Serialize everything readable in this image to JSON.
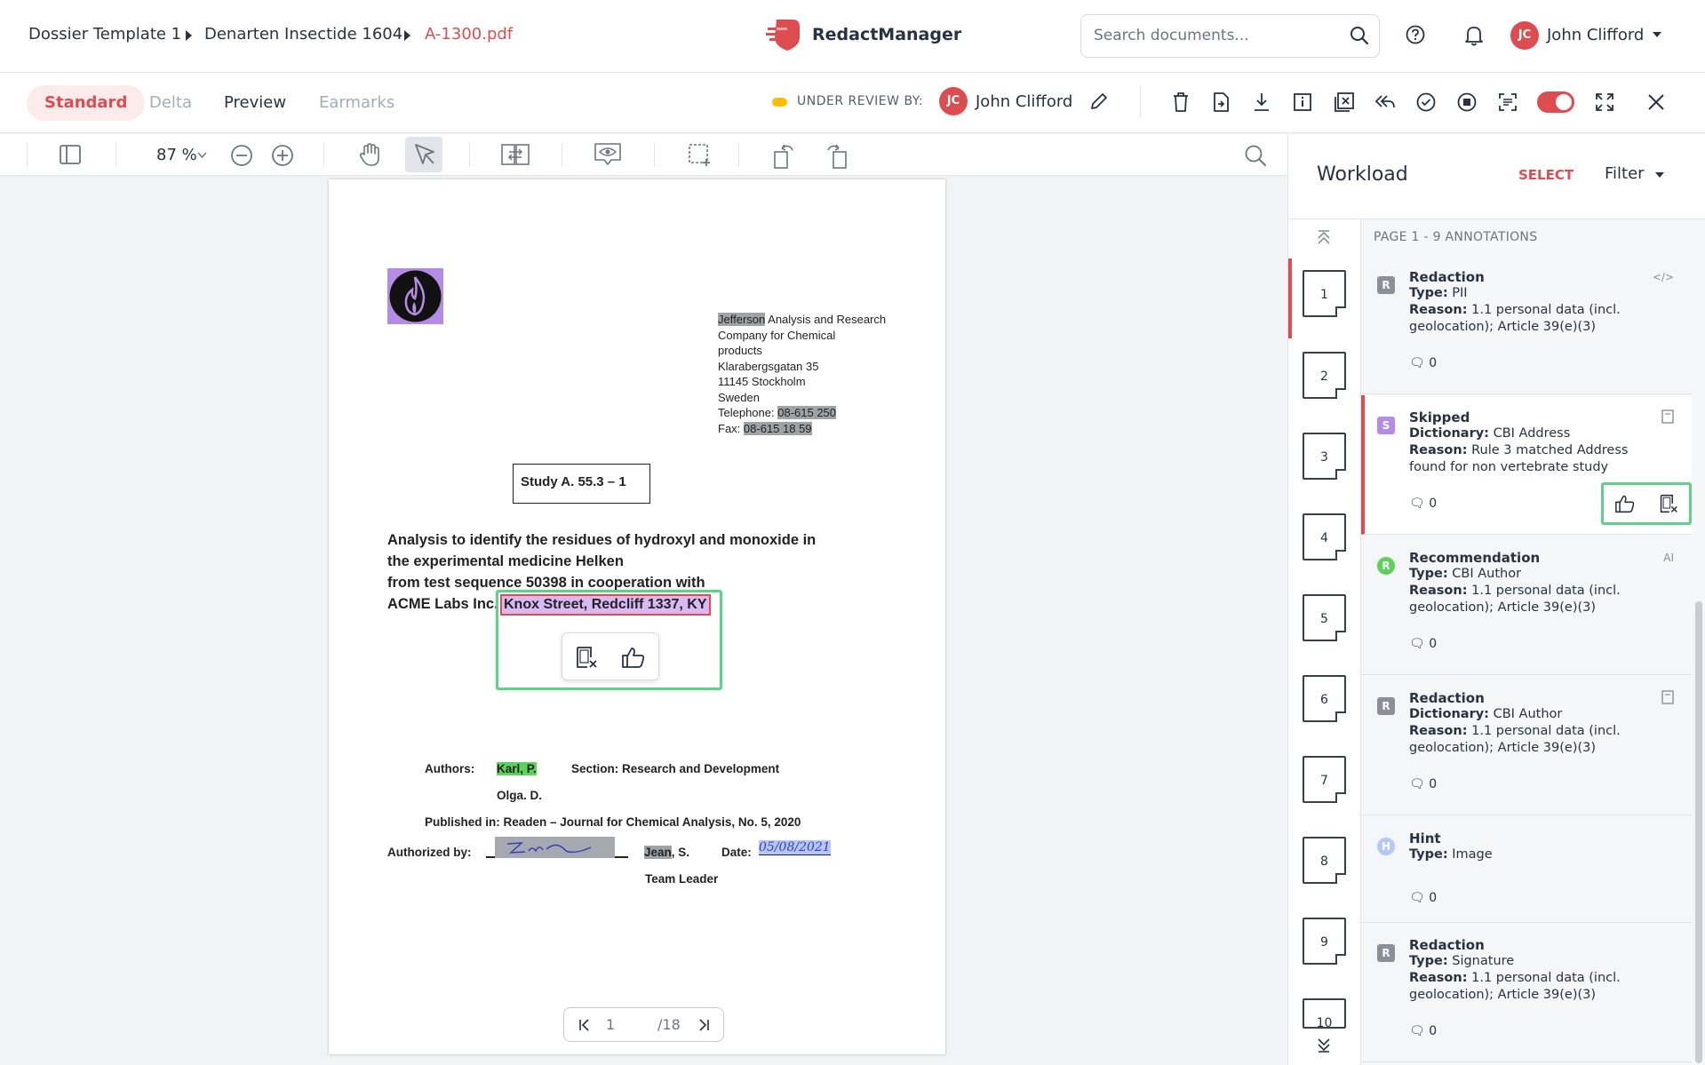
{
  "breadcrumb": {
    "items": [
      "Dossier Template 1",
      "Denarten Insectide 1604",
      "A-1300.pdf"
    ]
  },
  "brand": {
    "name": "RedactManager",
    "color": "#dd4d50"
  },
  "search": {
    "placeholder": "Search documents..."
  },
  "user": {
    "initials": "JC",
    "name": "John Clifford"
  },
  "modes": {
    "standard": "Standard",
    "delta": "Delta",
    "preview": "Preview",
    "earmarks": "Earmarks"
  },
  "review": {
    "label": "UNDER REVIEW BY:",
    "initials": "JC",
    "name": "John Clifford"
  },
  "viewer": {
    "zoom": "87 %"
  },
  "document": {
    "sender": {
      "name_hl": "Jefferson",
      "name_rest": " Analysis and Research",
      "line2": "Company for Chemical",
      "line3": "products",
      "street": "Klarabergsgatan 35",
      "city": "11145 Stockholm",
      "country": "Sweden",
      "tel_label": "Telephone: ",
      "tel_value": "08-615 250",
      "fax_label": "Fax: ",
      "fax_value": "08-615 18 59"
    },
    "study_box": "Study A. 55.3 – 1",
    "title_lines": [
      "Analysis to identify the residues of hydroxyl and monoxide in",
      "the experimental medicine Helken",
      "from test sequence 50398 in cooperation with"
    ],
    "lab_prefix": "ACME Labs Inc.",
    "lab_address": "Knox Street, Redcliff 1337, KY",
    "authors_label": "Authors:",
    "author1": "Karl, P.",
    "author2": "Olga. D.",
    "section": "Section: Research and Development",
    "published": "Published in: Readen – Journal for Chemical Analysis, No. 5, 2020",
    "authorized_label": "Authorized by:",
    "signer_hl": "Jean",
    "signer_rest": ", S.",
    "date_label": "Date:",
    "date_value": "05/08/2021",
    "team_leader": "Team Leader"
  },
  "pager": {
    "current": "1",
    "total": "/18"
  },
  "panel": {
    "title": "Workload",
    "select": "SELECT",
    "filter": "Filter",
    "header": "PAGE 1 - 9 ANNOTATIONS",
    "thumbs": [
      "1",
      "2",
      "3",
      "4",
      "5",
      "6",
      "7",
      "8",
      "9",
      "10"
    ],
    "cards": [
      {
        "badge": "R",
        "badge_color": "#8a8f99",
        "title": "Redaction",
        "l1k": "Type:",
        "l1v": " PII",
        "l2k": "Reason:",
        "l2v": " 1.1 personal data (incl. geolocation); Article 39(e)(3)",
        "comments": "0",
        "corner": "</>"
      },
      {
        "badge": "S",
        "badge_color": "#b48ce6",
        "title": "Skipped",
        "l1k": "Dictionary:",
        "l1v": " CBI Address",
        "l2k": "Reason:",
        "l2v": " Rule 3 matched Address found for non vertebrate study",
        "comments": "0",
        "corner": ""
      },
      {
        "badge": "R",
        "badge_color": "#5bd35b",
        "title": "Recommendation",
        "l1k": "Type:",
        "l1v": " CBI Author",
        "l2k": "Reason:",
        "l2v": " 1.1 personal data (incl. geolocation); Article 39(e)(3)",
        "comments": "0",
        "corner": "AI"
      },
      {
        "badge": "R",
        "badge_color": "#8a8f99",
        "title": "Redaction",
        "l1k": "Dictionary:",
        "l1v": " CBI Author",
        "l2k": "Reason:",
        "l2v": " 1.1 personal data (incl. geolocation); Article 39(e)(3)",
        "comments": "0",
        "corner": ""
      },
      {
        "badge": "H",
        "badge_color": "#b5c7f5",
        "title": "Hint",
        "l1k": "Type:",
        "l1v": " Image",
        "l2k": "",
        "l2v": "",
        "comments": "0",
        "corner": ""
      },
      {
        "badge": "R",
        "badge_color": "#8a8f99",
        "title": "Redaction",
        "l1k": "Type:",
        "l1v": " Signature",
        "l2k": "Reason:",
        "l2v": " 1.1 personal data (incl. geolocation); Article 39(e)(3)",
        "comments": "0",
        "corner": ""
      }
    ]
  },
  "colors": {
    "accent": "#dd4d50",
    "highlight_box": "#5ed28a",
    "toggle_on": "#dd4d50"
  }
}
